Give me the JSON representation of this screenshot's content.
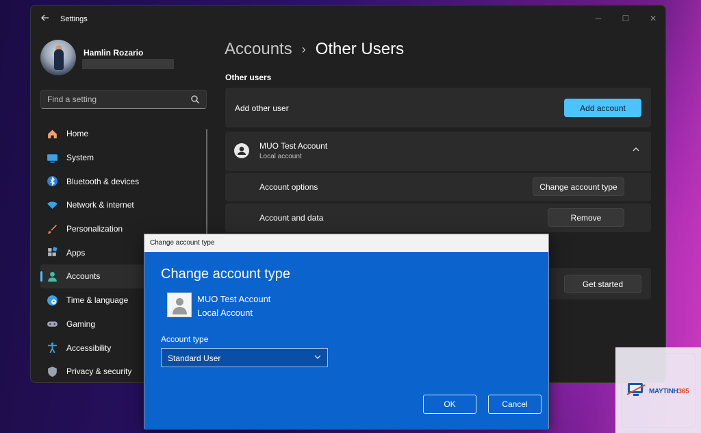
{
  "window": {
    "title": "Settings",
    "back_icon": "back-arrow-icon",
    "controls": {
      "minimize": "─",
      "maximize": "☐",
      "close": "✕"
    }
  },
  "profile": {
    "name": "Hamlin Rozario"
  },
  "search": {
    "placeholder": "Find a setting"
  },
  "sidebar": {
    "items": [
      {
        "label": "Home",
        "icon": "home-icon",
        "active": false
      },
      {
        "label": "System",
        "icon": "system-icon",
        "active": false
      },
      {
        "label": "Bluetooth & devices",
        "icon": "bluetooth-icon",
        "active": false
      },
      {
        "label": "Network & internet",
        "icon": "wifi-icon",
        "active": false
      },
      {
        "label": "Personalization",
        "icon": "brush-icon",
        "active": false
      },
      {
        "label": "Apps",
        "icon": "apps-icon",
        "active": false
      },
      {
        "label": "Accounts",
        "icon": "accounts-icon",
        "active": true
      },
      {
        "label": "Time & language",
        "icon": "clock-globe-icon",
        "active": false
      },
      {
        "label": "Gaming",
        "icon": "gamepad-icon",
        "active": false
      },
      {
        "label": "Accessibility",
        "icon": "accessibility-icon",
        "active": false
      },
      {
        "label": "Privacy & security",
        "icon": "shield-icon",
        "active": false
      }
    ]
  },
  "breadcrumb": {
    "parent": "Accounts",
    "separator": "›",
    "current": "Other Users"
  },
  "main": {
    "section_heading": "Other users",
    "add_user": {
      "label": "Add other user",
      "button": "Add account"
    },
    "user": {
      "name": "MUO Test Account",
      "type": "Local account",
      "options_label": "Account options",
      "change_type_button": "Change account type",
      "data_label": "Account and data",
      "remove_button": "Remove"
    },
    "get_started_button": "Get started"
  },
  "dialog": {
    "window_title": "Change account type",
    "heading": "Change account type",
    "account_name": "MUO Test Account",
    "account_type_text": "Local Account",
    "field_label": "Account type",
    "selected_value": "Standard User",
    "ok_button": "OK",
    "cancel_button": "Cancel"
  },
  "watermark": {
    "brand_main": "MAYTINH",
    "brand_num": "365"
  },
  "colors": {
    "accent": "#4cc2ff",
    "dialog_bg": "#0b63ce",
    "window_bg": "#202020",
    "card_bg": "#2b2b2b"
  }
}
